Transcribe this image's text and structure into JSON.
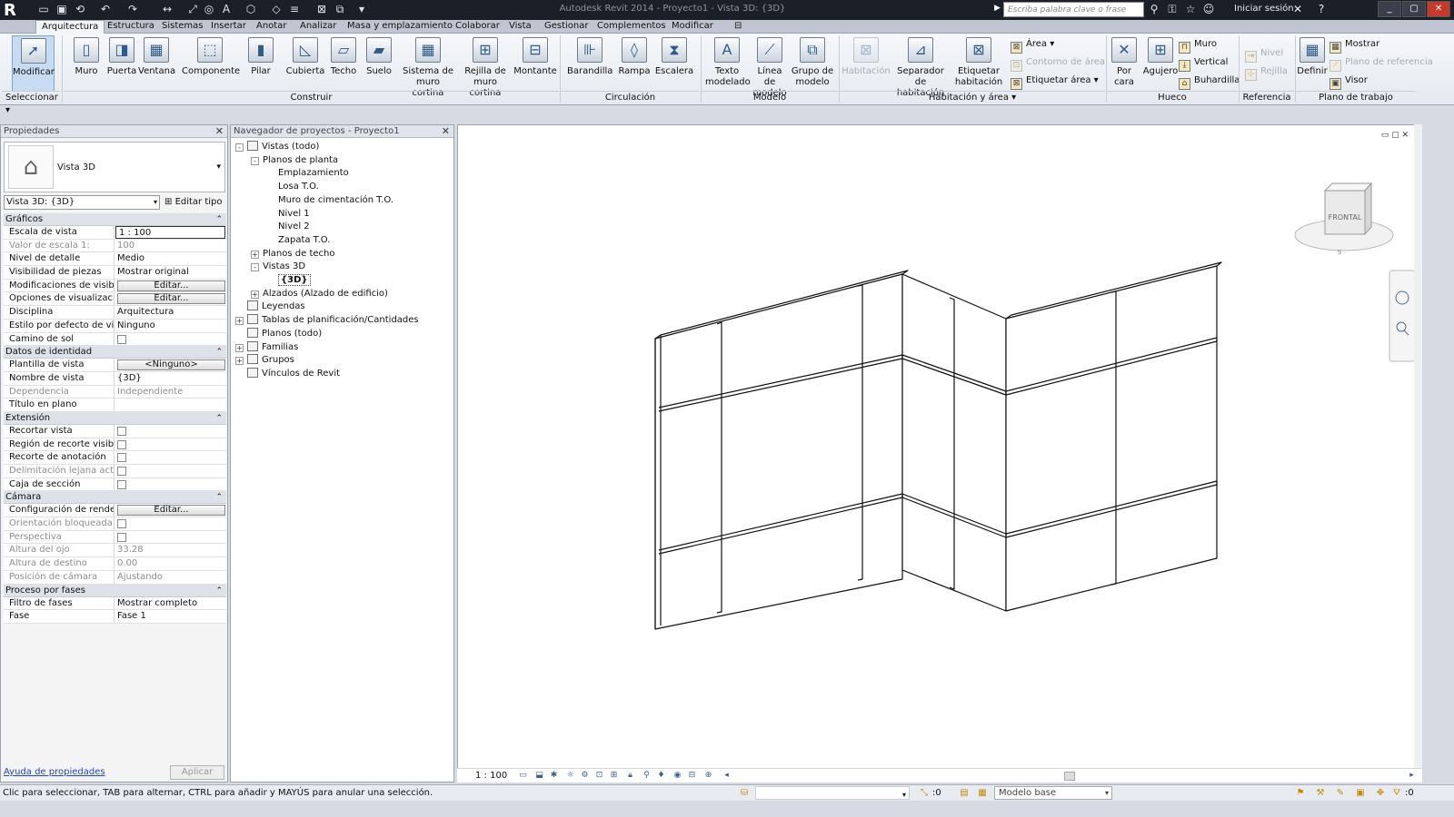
{
  "titlebar": {
    "window_title": "Autodesk Revit 2014 -    Proyecto1 - Vista 3D: {3D}",
    "search_placeholder": "Escriba palabra clave o frase",
    "signin": "Iniciar sesión"
  },
  "ribbon_tabs": [
    "Arquitectura",
    "Estructura",
    "Sistemas",
    "Insertar",
    "Anotar",
    "Analizar",
    "Masa y emplazamiento",
    "Colaborar",
    "Vista",
    "Gestionar",
    "Complementos",
    "Modificar"
  ],
  "ribbon": {
    "modificar": "Modificar",
    "seleccionar": "Seleccionar",
    "construir": {
      "title": "Construir",
      "buttons": [
        "Muro",
        "Puerta",
        "Ventana",
        "Componente",
        "Pilar",
        "Cubierta",
        "Techo",
        "Suelo",
        "Sistema de muro cortina",
        "Rejilla de muro cortina",
        "Montante"
      ]
    },
    "circulacion": {
      "title": "Circulación",
      "buttons": [
        "Barandilla",
        "Rampa",
        "Escalera"
      ]
    },
    "modelo": {
      "title": "Modelo",
      "buttons": [
        "Texto modelado",
        "Línea de modelo",
        "Grupo de modelo"
      ]
    },
    "habitacion": {
      "title": "Habitación y área",
      "buttons": [
        "Habitación",
        "Separador de habitación",
        "Etiquetar habitación"
      ],
      "small": [
        "Área",
        "Contorno de área",
        "Etiquetar área"
      ]
    },
    "hueco": {
      "title": "Hueco",
      "buttons": [
        "Por cara",
        "Agujero"
      ],
      "small": [
        "Muro",
        "Vertical",
        "Buhardilla"
      ]
    },
    "referencia": {
      "title": "Referencia",
      "small": [
        "Nivel",
        "Rejilla"
      ]
    },
    "plano": {
      "title": "Plano de trabajo",
      "buttons": [
        "Definir"
      ],
      "small": [
        "Mostrar",
        "Plano de referencia",
        "Visor"
      ]
    }
  },
  "properties": {
    "title": "Propiedades",
    "type_name": "Vista 3D",
    "view_selector": "Vista 3D: {3D}",
    "edit_type": "Editar tipo",
    "sections": [
      {
        "name": "Gráficos",
        "rows": [
          {
            "k": "Escala de vista",
            "v": "1 : 100",
            "style": "box"
          },
          {
            "k": "Valor de escala    1:",
            "v": "100",
            "dim": true
          },
          {
            "k": "Nivel de detalle",
            "v": "Medio"
          },
          {
            "k": "Visibilidad de piezas",
            "v": "Mostrar original"
          },
          {
            "k": "Modificaciones de visibi...",
            "v": "Editar...",
            "style": "btn"
          },
          {
            "k": "Opciones de visualizació...",
            "v": "Editar...",
            "style": "btn"
          },
          {
            "k": "Disciplina",
            "v": "Arquitectura"
          },
          {
            "k": "Estilo por defecto de vis...",
            "v": "Ninguno"
          },
          {
            "k": "Camino de sol",
            "v": "",
            "style": "chk"
          }
        ]
      },
      {
        "name": "Datos de identidad",
        "rows": [
          {
            "k": "Plantilla de vista",
            "v": "<Ninguno>",
            "style": "btn"
          },
          {
            "k": "Nombre de vista",
            "v": "{3D}"
          },
          {
            "k": "Dependencia",
            "v": "Independiente",
            "dim": true
          },
          {
            "k": "Título en plano",
            "v": ""
          }
        ]
      },
      {
        "name": "Extensión",
        "rows": [
          {
            "k": "Recortar vista",
            "v": "",
            "style": "chk"
          },
          {
            "k": "Región de recorte visible",
            "v": "",
            "style": "chk"
          },
          {
            "k": "Recorte de anotación",
            "v": "",
            "style": "chk"
          },
          {
            "k": "Delimitación lejana activa",
            "v": "",
            "style": "chk",
            "dim": true
          },
          {
            "k": "Caja de sección",
            "v": "",
            "style": "chk"
          }
        ]
      },
      {
        "name": "Cámara",
        "rows": [
          {
            "k": "Configuración de render...",
            "v": "Editar...",
            "style": "btn"
          },
          {
            "k": "Orientación bloqueada",
            "v": "",
            "style": "chk",
            "dim": true
          },
          {
            "k": "Perspectiva",
            "v": "",
            "style": "chk",
            "dim": true
          },
          {
            "k": "Altura del ojo",
            "v": "33.28",
            "dim": true
          },
          {
            "k": "Altura de destino",
            "v": "0.00",
            "dim": true
          },
          {
            "k": "Posición de cámara",
            "v": "Ajustando",
            "dim": true
          }
        ]
      },
      {
        "name": "Proceso por fases",
        "rows": [
          {
            "k": "Filtro de fases",
            "v": "Mostrar completo"
          },
          {
            "k": "Fase",
            "v": "Fase 1"
          }
        ]
      }
    ],
    "help": "Ayuda de propiedades",
    "apply": "Aplicar"
  },
  "browser": {
    "title": "Navegador de proyectos - Proyecto1",
    "items": [
      {
        "label": "Vistas (todo)",
        "level": 0,
        "tog": "-",
        "icon": true
      },
      {
        "label": "Planos de planta",
        "level": 1,
        "tog": "-"
      },
      {
        "label": "Emplazamiento",
        "level": 2
      },
      {
        "label": "Losa T.O.",
        "level": 2
      },
      {
        "label": "Muro de cimentación T.O.",
        "level": 2
      },
      {
        "label": "Nivel 1",
        "level": 2
      },
      {
        "label": "Nivel 2",
        "level": 2
      },
      {
        "label": "Zapata T.O.",
        "level": 2
      },
      {
        "label": "Planos de techo",
        "level": 1,
        "tog": "+"
      },
      {
        "label": "Vistas 3D",
        "level": 1,
        "tog": "-"
      },
      {
        "label": "{3D}",
        "level": 2,
        "selected": true
      },
      {
        "label": "Alzados (Alzado de edificio)",
        "level": 1,
        "tog": "+"
      },
      {
        "label": "Leyendas",
        "level": 0,
        "icon": true
      },
      {
        "label": "Tablas de planificación/Cantidades",
        "level": 0,
        "tog": "+",
        "icon": true
      },
      {
        "label": "Planos (todo)",
        "level": 0,
        "icon": true
      },
      {
        "label": "Familias",
        "level": 0,
        "tog": "+",
        "icon": true
      },
      {
        "label": "Grupos",
        "level": 0,
        "tog": "+",
        "icon": true
      },
      {
        "label": "Vínculos de Revit",
        "level": 0,
        "icon": true
      }
    ]
  },
  "viewport": {
    "scale": "1 : 100",
    "viewcube_face": "FRONTAL"
  },
  "statusbar": {
    "message": "Clic para seleccionar, TAB para alternar, CTRL para añadir y MAYÚS para anular una selección.",
    "zero": ":0",
    "model": "Modelo base",
    "filter_zero": ":0"
  }
}
